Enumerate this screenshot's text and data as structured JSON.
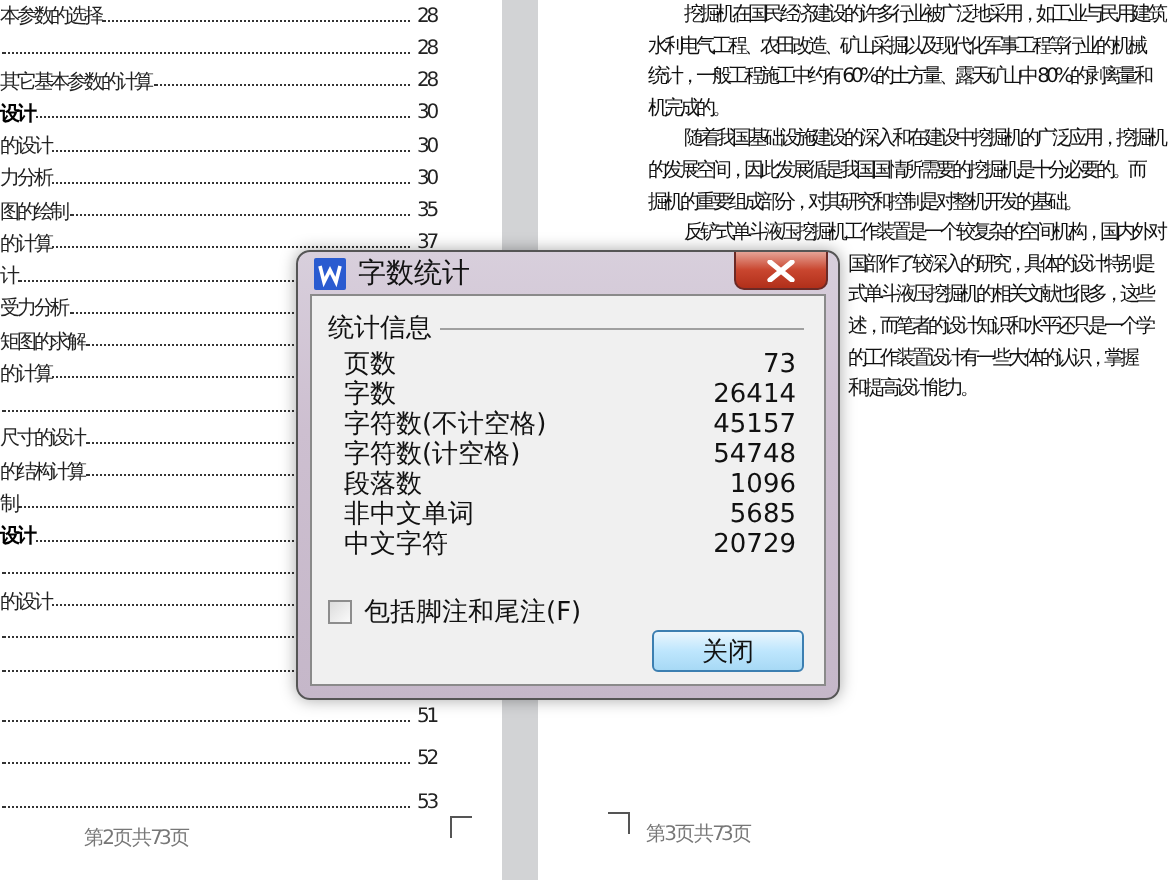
{
  "left_page": {
    "toc": [
      {
        "kind": "entry",
        "label": "本参数的选择",
        "page": "28",
        "bold": false
      },
      {
        "kind": "leader",
        "page": "28"
      },
      {
        "kind": "entry",
        "label": "其它基本参数的计算",
        "page": "28",
        "bold": false
      },
      {
        "kind": "entry",
        "label": "设计",
        "page": "30",
        "bold": true
      },
      {
        "kind": "entry",
        "label": "的设计",
        "page": "30",
        "bold": false
      },
      {
        "kind": "entry",
        "label": "力分析",
        "page": "30",
        "bold": false
      },
      {
        "kind": "entry",
        "label": "图的绘制",
        "page": "35",
        "bold": false
      },
      {
        "kind": "entry",
        "label": "的计算",
        "page": "37",
        "bold": false
      },
      {
        "kind": "entry",
        "label": "计",
        "bold": false
      },
      {
        "kind": "entry",
        "label": "受力分析",
        "bold": false
      },
      {
        "kind": "entry",
        "label": "矩图的求解",
        "bold": false
      },
      {
        "kind": "entry",
        "label": "的计算",
        "bold": false
      },
      {
        "kind": "leader"
      },
      {
        "kind": "entry",
        "label": "尺寸的设计",
        "bold": false
      },
      {
        "kind": "entry",
        "label": "的结构计算",
        "bold": false
      },
      {
        "kind": "entry",
        "label": "制",
        "bold": false
      },
      {
        "kind": "entry",
        "label": "设计",
        "bold": true
      },
      {
        "kind": "leader"
      },
      {
        "kind": "entry",
        "label": "的设计",
        "bold": false
      },
      {
        "kind": "leader"
      },
      {
        "kind": "leader"
      },
      {
        "kind": "leader",
        "page": "51"
      },
      {
        "kind": "leader",
        "page": "52"
      },
      {
        "kind": "leader",
        "page": "53"
      }
    ],
    "footer": "第 2 页 共 73 页"
  },
  "right_page": {
    "lines": [
      {
        "kind": "first",
        "text": "挖掘机在国民经济建设的许多行业被广泛地采用，如工业与民用建筑"
      },
      {
        "kind": "line",
        "text": "水利电气工程、农田改造、矿山采掘以及现代化军事工程等行业的机械"
      },
      {
        "kind": "line",
        "text": "统计，一般工程施工中约有 60%的土方量、露天矿山中 80%的剥离量和"
      },
      {
        "kind": "line",
        "text": "机完成的。"
      },
      {
        "kind": "first",
        "text": "随着我国基础设施建设的深入和在建设中挖掘机的广泛应用，挖掘机"
      },
      {
        "kind": "line",
        "text": "的发展空间，因此发展循是我国国情所需要的挖掘机是十分必要的。而"
      },
      {
        "kind": "line",
        "text": "掘机的重要组成部分，对其研究和控制是对整机开发的基础。"
      },
      {
        "kind": "first",
        "text": "反铲式单斗液压挖掘机工作装置是一个较复杂的空间机构，国内外对"
      },
      {
        "kind": "partial",
        "text": "国部作了较深入的研究，具体的设计特别是"
      },
      {
        "kind": "partial",
        "text": "式单斗液压挖掘机的相关文献也很多，这些"
      },
      {
        "kind": "partial",
        "text": "述，而笔者的设计知识和水平还只是一个学"
      },
      {
        "kind": "partial",
        "text": "的工作装置设计有一些大体的认识，掌握"
      },
      {
        "kind": "partial",
        "text": "和提高设计能力。"
      }
    ],
    "footer": "第 3 页 共 73 页"
  },
  "dialog": {
    "title": "字数统计",
    "group_title": "统计信息",
    "stats": [
      {
        "label": "页数",
        "value": "73"
      },
      {
        "label": "字数",
        "value": "26414"
      },
      {
        "label": "字符数(不计空格)",
        "value": "45157"
      },
      {
        "label": "字符数(计空格)",
        "value": "54748"
      },
      {
        "label": "段落数",
        "value": "1096"
      },
      {
        "label": "非中文单词",
        "value": "5685"
      },
      {
        "label": "中文字符",
        "value": "20729"
      }
    ],
    "footnotes_checkbox": {
      "label": "包括脚注和尾注(F)",
      "checked": false
    },
    "close_button": "关闭"
  }
}
